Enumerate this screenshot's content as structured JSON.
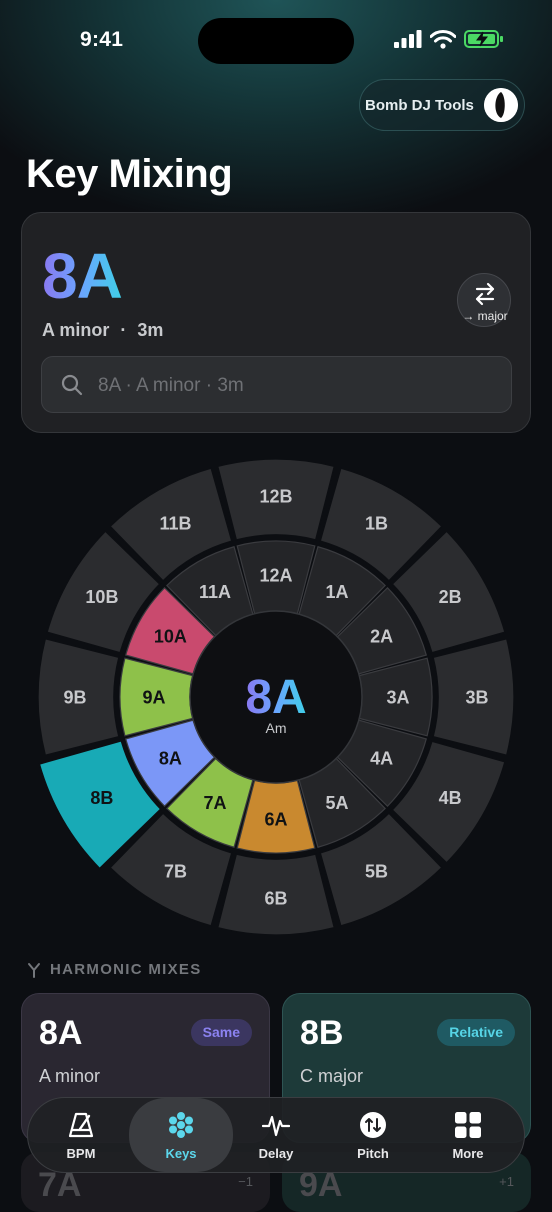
{
  "status_bar": {
    "time": "9:41"
  },
  "brand": {
    "label": "Bomb DJ Tools"
  },
  "page": {
    "title": "Key Mixing"
  },
  "current_key": {
    "camelot": "8A",
    "name": "A minor",
    "separator": "·",
    "short": "3m",
    "toggle_label": "→ major",
    "search_placeholder": "8A · A minor · 3m"
  },
  "wheel": {
    "center_key": "8A",
    "center_sub": "Am",
    "outer": [
      "1B",
      "2B",
      "3B",
      "4B",
      "5B",
      "6B",
      "7B",
      "8B",
      "9B",
      "10B",
      "11B",
      "12B"
    ],
    "inner": [
      "1A",
      "2A",
      "3A",
      "4A",
      "5A",
      "6A",
      "7A",
      "8A",
      "9A",
      "10A",
      "11A",
      "12A"
    ],
    "highlights": {
      "8B": "#18aab6",
      "8A": "#7b97f7",
      "7A": "#8ec14a",
      "9A": "#8ec14a",
      "6A": "#c9892f",
      "10A": "#c94a6e"
    },
    "base_outer_color": "#2b2c2f",
    "base_inner_color": "#242528"
  },
  "harmonic": {
    "section_label": "HARMONIC MIXES",
    "cards": [
      {
        "key": "8A",
        "name": "A minor",
        "badge": "Same"
      },
      {
        "key": "8B",
        "name": "C major",
        "badge": "Relative"
      }
    ],
    "next_cards": [
      {
        "key": "7A",
        "delta": "−1"
      },
      {
        "key": "9A",
        "delta": "+1"
      }
    ]
  },
  "tabbar": {
    "active": "Keys",
    "tabs": [
      {
        "label": "BPM",
        "icon": "metronome-icon"
      },
      {
        "label": "Keys",
        "icon": "hexagon-cluster-icon"
      },
      {
        "label": "Delay",
        "icon": "waveform-icon"
      },
      {
        "label": "Pitch",
        "icon": "pitch-arrows-icon"
      },
      {
        "label": "More",
        "icon": "grid-icon"
      }
    ]
  },
  "colors": {
    "accent": "#5cd7ec",
    "background": "#0c0e12"
  }
}
